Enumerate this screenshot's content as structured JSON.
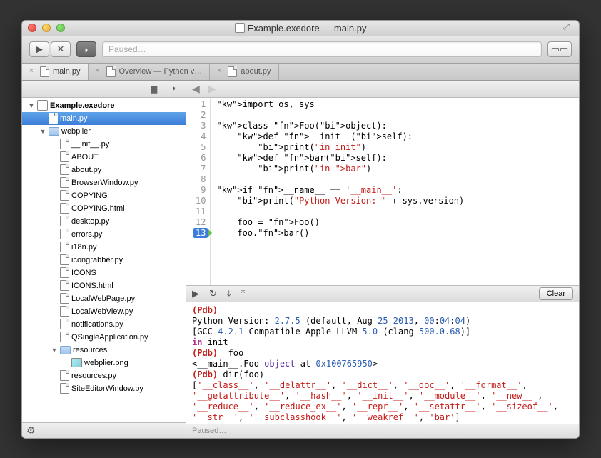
{
  "window": {
    "title": "Example.exedore — main.py"
  },
  "toolbar": {
    "search_placeholder": "Paused…"
  },
  "tabs": [
    {
      "label": "main.py",
      "active": true
    },
    {
      "label": "Overview — Python v…",
      "active": false
    },
    {
      "label": "about.py",
      "active": false
    }
  ],
  "project": {
    "name": "Example.exedore",
    "selected": "main.py",
    "tree": [
      {
        "label": "main.py",
        "type": "file",
        "depth": 1,
        "selected": true
      },
      {
        "label": "webplier",
        "type": "folder",
        "depth": 1,
        "expanded": true
      },
      {
        "label": "__init__.py",
        "type": "file",
        "depth": 2
      },
      {
        "label": "ABOUT",
        "type": "file",
        "depth": 2
      },
      {
        "label": "about.py",
        "type": "file",
        "depth": 2
      },
      {
        "label": "BrowserWindow.py",
        "type": "file",
        "depth": 2
      },
      {
        "label": "COPYING",
        "type": "file",
        "depth": 2
      },
      {
        "label": "COPYING.html",
        "type": "file",
        "depth": 2
      },
      {
        "label": "desktop.py",
        "type": "file",
        "depth": 2
      },
      {
        "label": "errors.py",
        "type": "file",
        "depth": 2
      },
      {
        "label": "i18n.py",
        "type": "file",
        "depth": 2
      },
      {
        "label": "icongrabber.py",
        "type": "file",
        "depth": 2
      },
      {
        "label": "ICONS",
        "type": "file",
        "depth": 2
      },
      {
        "label": "ICONS.html",
        "type": "file",
        "depth": 2
      },
      {
        "label": "LocalWebPage.py",
        "type": "file",
        "depth": 2
      },
      {
        "label": "LocalWebView.py",
        "type": "file",
        "depth": 2
      },
      {
        "label": "notifications.py",
        "type": "file",
        "depth": 2
      },
      {
        "label": "QSingleApplication.py",
        "type": "file",
        "depth": 2
      },
      {
        "label": "resources",
        "type": "folder",
        "depth": 2,
        "expanded": true
      },
      {
        "label": "webplier.png",
        "type": "image",
        "depth": 3
      },
      {
        "label": "resources.py",
        "type": "file",
        "depth": 2
      },
      {
        "label": "SiteEditorWindow.py",
        "type": "file",
        "depth": 2
      }
    ]
  },
  "code": {
    "current_line": 13,
    "lines": [
      "import os, sys",
      "",
      "class Foo(object):",
      "    def __init__(self):",
      "        print(\"in init\")",
      "    def bar(self):",
      "        print(\"in bar\")",
      "",
      "if __name__ == '__main__':",
      "    print(\"Python Version: \" + sys.version)",
      "",
      "    foo = Foo()",
      "    foo.bar()"
    ]
  },
  "debug": {
    "clear_label": "Clear"
  },
  "console": {
    "pdb": "(Pdb)",
    "line_version": "Python Version: 2.7.5 (default, Aug 25 2013, 00:04:04)",
    "line_gcc": "[GCC 4.2.1 Compatible Apple LLVM 5.0 (clang-500.0.68)]",
    "line_init": "in init",
    "input_foo": "(Pdb)  foo",
    "foo_repr": "<__main__.Foo object at 0x100765950>",
    "input_dir": "(Pdb) dir(foo)",
    "dir_result": "['__class__', '__delattr__', '__dict__', '__doc__', '__format__', '__getattribute__', '__hash__', '__init__', '__module__', '__new__', '__reduce__', '__reduce_ex__', '__repr__', '__setattr__', '__sizeof__', '__str__', '__subclasshook__', '__weakref__', 'bar']"
  },
  "status": {
    "text": "Paused…"
  }
}
